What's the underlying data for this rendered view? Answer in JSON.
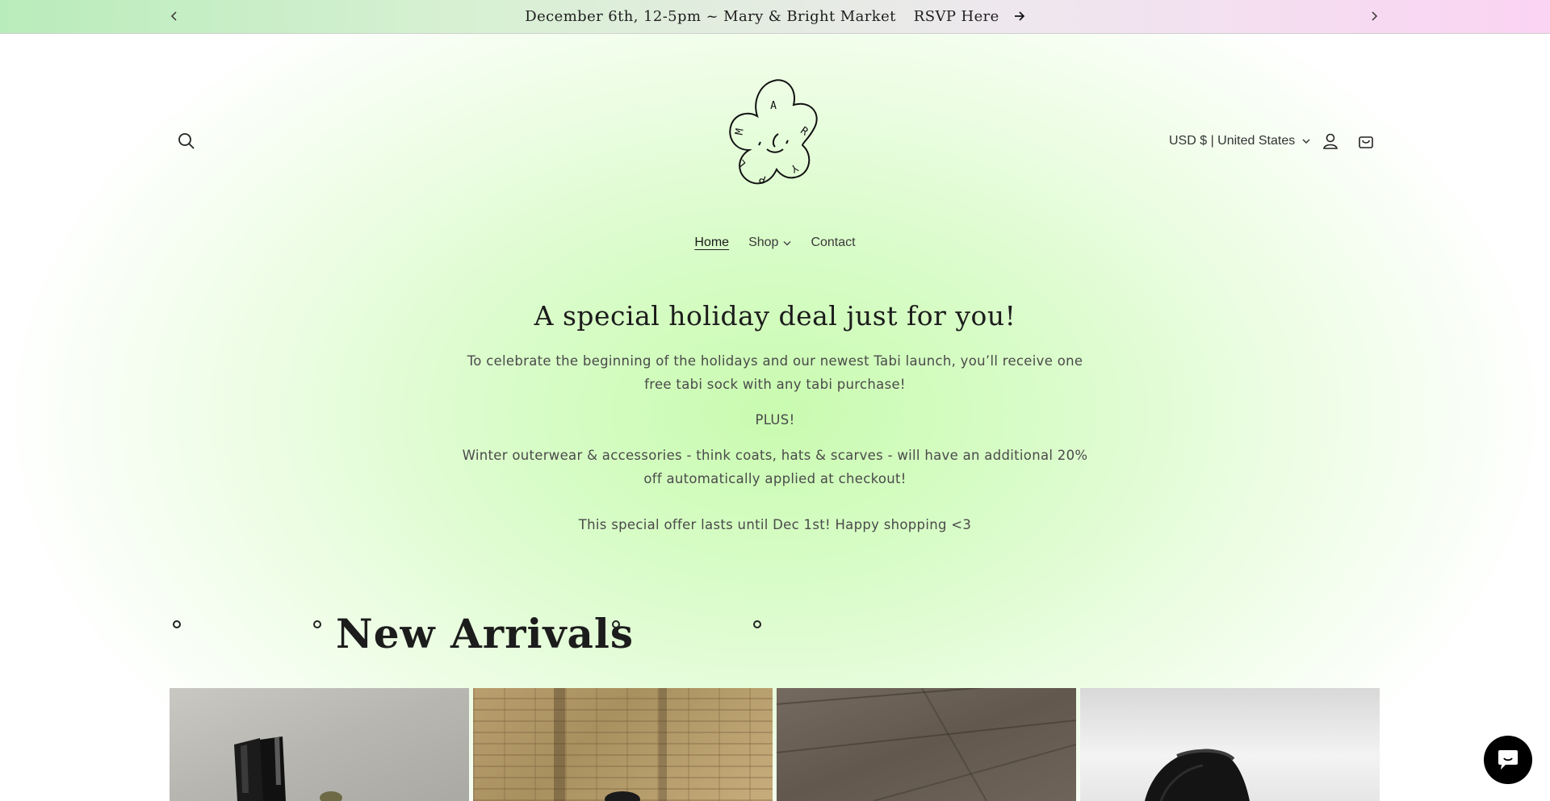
{
  "announcement": {
    "message": "December 6th, 12-5pm ~ Mary & Bright Market",
    "link_label": "RSVP Here",
    "prev_icon": "chevron-left-icon",
    "next_icon": "chevron-right-icon",
    "arrow_icon": "arrow-right-icon"
  },
  "header": {
    "logo_alt": "Mary logo",
    "logo_letters": [
      "A",
      "R",
      "Y",
      "P",
      "L",
      "M"
    ],
    "currency_label": "USD $ | United States",
    "icons": {
      "search": "search-icon",
      "account": "account-icon",
      "cart": "cart-icon",
      "currency_chevron": "chevron-down-icon"
    }
  },
  "nav": {
    "items": [
      {
        "label": "Home",
        "active": true
      },
      {
        "label": "Shop",
        "has_dropdown": true
      },
      {
        "label": "Contact"
      }
    ]
  },
  "promo": {
    "heading": "A special holiday deal just for you!",
    "paragraph1": "To celebrate the beginning of the holidays and our newest Tabi launch, you’ll receive one free tabi sock with any tabi purchase!",
    "paragraph2": "PLUS!",
    "paragraph3": "Winter outerwear & accessories - think coats, hats & scarves - will have an additional 20% off automatically applied at checkout!",
    "paragraph4": "This special offer lasts until Dec 1st! Happy shopping <3"
  },
  "arrivals": {
    "title": "New Arrivals",
    "products": [
      {
        "image": "black-ankle-boots-on-pavement"
      },
      {
        "image": "brick-wall-photo"
      },
      {
        "image": "wood-floor-photo"
      },
      {
        "image": "black-loafers-photo"
      }
    ]
  },
  "chat": {
    "icon": "chat-bubble-icon"
  },
  "colors": {
    "announcement_left": "#b9ecbb",
    "announcement_right": "#fbd3f3",
    "hero_center": "#c9fbb0",
    "text_dark": "#1c1c1c",
    "chat_button": "#000000"
  }
}
